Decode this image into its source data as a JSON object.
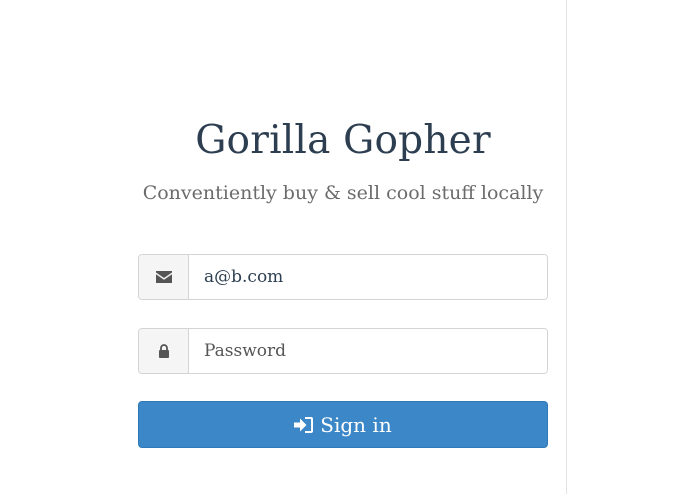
{
  "app": {
    "title": "Gorilla Gopher",
    "tagline": "Conventiently buy & sell cool stuff locally"
  },
  "login_form": {
    "email": {
      "icon": "envelope-icon",
      "value": "a@b.com",
      "placeholder": ""
    },
    "password": {
      "icon": "lock-icon",
      "value": "",
      "placeholder": "Password"
    },
    "submit": {
      "icon": "sign-in-icon",
      "label": "Sign in"
    }
  },
  "colors": {
    "title": "#2c3e50",
    "tagline": "#6b6b6b",
    "button_bg": "#3b87c8",
    "button_text": "#ffffff",
    "input_border": "#d4d4d4",
    "addon_bg": "#f5f5f5",
    "divider": "#e3e3e3"
  }
}
